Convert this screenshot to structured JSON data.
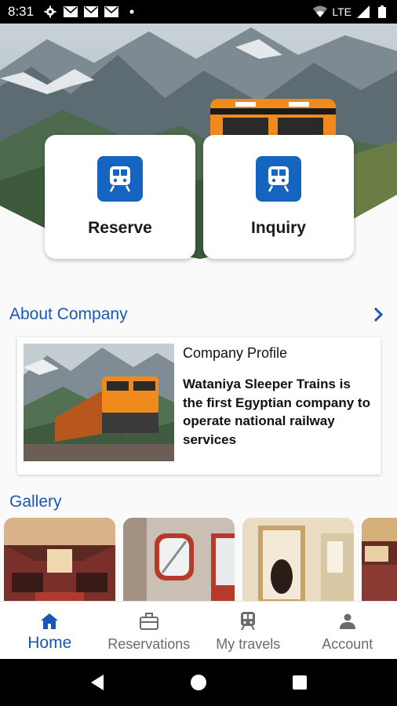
{
  "status_bar": {
    "time": "8:31",
    "network": "LTE",
    "icons": [
      "gear-icon",
      "mail-icon",
      "mail-icon",
      "mail-icon",
      "dot-icon",
      "wifi-icon",
      "signal-icon",
      "battery-icon"
    ]
  },
  "actions": {
    "reserve_label": "Reserve",
    "inquiry_label": "Inquiry",
    "icon": "train-icon",
    "icon_color": "#1565c0"
  },
  "about": {
    "title": "About Company",
    "card_title": "Company Profile",
    "card_description": "Wataniya Sleeper Trains is the first Egyptian company to operate national railway services"
  },
  "gallery": {
    "title": "Gallery",
    "items": [
      "dining-car",
      "window-cabin",
      "sleeper-cabin",
      "lounge-car"
    ]
  },
  "bottom_nav": {
    "items": [
      {
        "label": "Home",
        "icon": "home-icon",
        "active": true
      },
      {
        "label": "Reservations",
        "icon": "briefcase-icon",
        "active": false
      },
      {
        "label": "My travels",
        "icon": "train-icon",
        "active": false
      },
      {
        "label": "Account",
        "icon": "person-icon",
        "active": false
      }
    ],
    "active_color": "#1a56b6",
    "inactive_color": "#6b6b6b"
  },
  "colors": {
    "accent": "#1a56b6",
    "icon_bg": "#1565c0",
    "train_orange": "#f08a1c"
  }
}
